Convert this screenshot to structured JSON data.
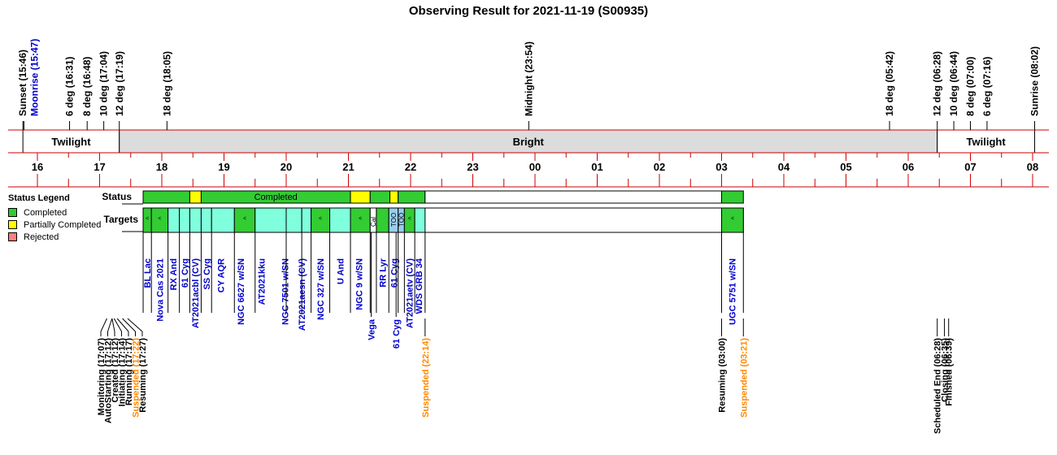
{
  "title": "Observing Result for 2021-11-19 (S00935)",
  "colors": {
    "completed": "#33cc33",
    "partial": "#ffff00",
    "rejected": "#ff8080",
    "twilight_fill": "#ffffff",
    "bright_fill": "#dcdcdc",
    "axis_red": "#cc0000",
    "label_blue": "#0000cc",
    "label_orange": "#ff8800",
    "target_cyan": "#80ffdd",
    "target_blue": "#99ccee"
  },
  "legend": {
    "title": "Status Legend",
    "items": [
      {
        "label": "Completed",
        "color": "#33cc33"
      },
      {
        "label": "Partially Completed",
        "color": "#ffff00"
      },
      {
        "label": "Rejected",
        "color": "#ff8080"
      }
    ]
  },
  "chart_data": {
    "type": "timeline",
    "x_unit": "hour (local time)",
    "xlim": [
      15.6,
      32.0
    ],
    "hour_ticks": [
      16,
      17,
      18,
      19,
      20,
      21,
      22,
      23,
      24,
      25,
      26,
      27,
      28,
      29,
      30,
      31,
      32
    ],
    "hour_tick_labels": [
      "16",
      "17",
      "18",
      "19",
      "20",
      "21",
      "22",
      "23",
      "00",
      "01",
      "02",
      "03",
      "04",
      "05",
      "06",
      "07",
      "08"
    ],
    "sky_events": [
      {
        "label": "Sunset (15:46)",
        "t": 15.767,
        "color": "black"
      },
      {
        "label": "Moonrise (15:47)",
        "t": 15.783,
        "color": "blue"
      },
      {
        "label": "6 deg (16:31)",
        "t": 16.517,
        "color": "black"
      },
      {
        "label": "8 deg (16:48)",
        "t": 16.8,
        "color": "black"
      },
      {
        "label": "10 deg (17:04)",
        "t": 17.067,
        "color": "black"
      },
      {
        "label": "12 deg (17:19)",
        "t": 17.317,
        "color": "black"
      },
      {
        "label": "18 deg (18:05)",
        "t": 18.083,
        "color": "black"
      },
      {
        "label": "Midnight (23:54)",
        "t": 23.9,
        "color": "black"
      },
      {
        "label": "18 deg (05:42)",
        "t": 29.7,
        "color": "black"
      },
      {
        "label": "12 deg (06:28)",
        "t": 30.467,
        "color": "black"
      },
      {
        "label": "10 deg (06:44)",
        "t": 30.733,
        "color": "black"
      },
      {
        "label": "8 deg (07:00)",
        "t": 31.0,
        "color": "black"
      },
      {
        "label": "6 deg (07:16)",
        "t": 31.267,
        "color": "black"
      },
      {
        "label": "Sunrise (08:02)",
        "t": 32.033,
        "color": "black"
      }
    ],
    "sky_bands": [
      {
        "label": "Twilight",
        "start": 15.767,
        "end": 17.317,
        "fill": "twilight"
      },
      {
        "label": "Bright",
        "start": 17.317,
        "end": 30.467,
        "fill": "bright"
      },
      {
        "label": "Twilight",
        "start": 30.467,
        "end": 32.033,
        "fill": "twilight"
      }
    ],
    "status_row_label": "Status",
    "status_segments": [
      {
        "start": 17.7,
        "end": 18.45,
        "status": "completed",
        "label": ""
      },
      {
        "start": 18.45,
        "end": 18.633,
        "status": "partial",
        "label": ""
      },
      {
        "start": 18.633,
        "end": 21.033,
        "status": "completed",
        "label": "Completed"
      },
      {
        "start": 21.033,
        "end": 21.35,
        "status": "partial",
        "label": ""
      },
      {
        "start": 21.35,
        "end": 21.667,
        "status": "completed",
        "label": ""
      },
      {
        "start": 21.667,
        "end": 21.8,
        "status": "partial",
        "label": ""
      },
      {
        "start": 21.8,
        "end": 22.233,
        "status": "completed",
        "label": ""
      },
      {
        "start": 22.233,
        "end": 27.0,
        "status": "idle",
        "label": ""
      },
      {
        "start": 27.0,
        "end": 27.35,
        "status": "completed",
        "label": ""
      }
    ],
    "targets_row_label": "Targets",
    "targets_frame": [
      17.7,
      27.35
    ],
    "target_segments": [
      {
        "start": 17.7,
        "end": 17.833,
        "fill": "completed",
        "mark": "<"
      },
      {
        "start": 17.833,
        "end": 18.1,
        "fill": "completed",
        "mark": "<"
      },
      {
        "start": 18.1,
        "end": 18.283,
        "fill": "cyan",
        "mark": ""
      },
      {
        "start": 18.283,
        "end": 18.45,
        "fill": "cyan",
        "mark": ""
      },
      {
        "start": 18.45,
        "end": 18.633,
        "fill": "cyan",
        "mark": ""
      },
      {
        "start": 18.633,
        "end": 18.8,
        "fill": "cyan",
        "mark": ""
      },
      {
        "start": 18.8,
        "end": 19.167,
        "fill": "cyan",
        "mark": ""
      },
      {
        "start": 19.167,
        "end": 19.5,
        "fill": "completed",
        "mark": "<"
      },
      {
        "start": 19.5,
        "end": 20.0,
        "fill": "cyan",
        "mark": ""
      },
      {
        "start": 20.0,
        "end": 20.25,
        "fill": "cyan",
        "mark": ""
      },
      {
        "start": 20.25,
        "end": 20.4,
        "fill": "cyan",
        "mark": ""
      },
      {
        "start": 20.4,
        "end": 20.7,
        "fill": "completed",
        "mark": "<"
      },
      {
        "start": 20.7,
        "end": 21.033,
        "fill": "cyan",
        "mark": ""
      },
      {
        "start": 21.033,
        "end": 21.35,
        "fill": "completed",
        "mark": "<"
      },
      {
        "start": 21.35,
        "end": 21.45,
        "fill": "white",
        "mark": "Cal"
      },
      {
        "start": 21.45,
        "end": 21.65,
        "fill": "completed",
        "mark": ""
      },
      {
        "start": 21.65,
        "end": 21.8,
        "fill": "blue",
        "mark": "TOO"
      },
      {
        "start": 21.8,
        "end": 21.9,
        "fill": "blue",
        "mark": "TOO"
      },
      {
        "start": 21.9,
        "end": 22.067,
        "fill": "completed",
        "mark": "<"
      },
      {
        "start": 22.067,
        "end": 22.233,
        "fill": "cyan",
        "mark": ""
      },
      {
        "start": 27.0,
        "end": 27.35,
        "fill": "completed",
        "mark": "<"
      }
    ],
    "target_labels": [
      {
        "label": "BL Lac",
        "t": 17.767,
        "color": "blue"
      },
      {
        "label": "Nova Cas 2021",
        "t": 17.967,
        "color": "blue"
      },
      {
        "label": "RX And",
        "t": 18.183,
        "color": "blue"
      },
      {
        "label": "61 Cyg",
        "t": 18.367,
        "color": "blue"
      },
      {
        "label": "AT2021acbl (CV)",
        "t": 18.533,
        "color": "blue"
      },
      {
        "label": "SS Cyg",
        "t": 18.717,
        "color": "blue"
      },
      {
        "label": "CY AQR",
        "t": 18.95,
        "color": "blue"
      },
      {
        "label": "NGC 6627 w/SN",
        "t": 19.267,
        "color": "blue"
      },
      {
        "label": "AT2021kku",
        "t": 19.6,
        "color": "blue"
      },
      {
        "label": "NGC 7501 w/SN",
        "t": 19.983,
        "color": "blue"
      },
      {
        "label": "AT2021aesn (CV)",
        "t": 20.25,
        "color": "blue"
      },
      {
        "label": "NGC 327 w/SN",
        "t": 20.55,
        "color": "blue"
      },
      {
        "label": "U And",
        "t": 20.867,
        "color": "blue"
      },
      {
        "label": "NGC 9 w/SN",
        "t": 21.167,
        "color": "blue"
      },
      {
        "label": "RR Lyr",
        "t": 21.55,
        "color": "blue"
      },
      {
        "label": "61 Cyg",
        "t": 21.733,
        "color": "blue"
      },
      {
        "label": "AT2021aetv (CV)",
        "t": 21.983,
        "color": "blue"
      },
      {
        "label": "WDS GRB 34",
        "t": 22.133,
        "color": "blue"
      },
      {
        "label": "UGC 5751 w/SN",
        "t": 27.167,
        "color": "blue"
      }
    ],
    "target_labels_low": [
      {
        "label": "Vega",
        "t": 21.367,
        "color": "blue"
      },
      {
        "label": "61 Cyg",
        "t": 21.767,
        "color": "blue"
      }
    ],
    "ops_events": [
      {
        "label": "Monitoring (17:07)",
        "t": 17.117,
        "color": "black"
      },
      {
        "label": "AutoStarting (17:12)",
        "t": 17.2,
        "color": "black"
      },
      {
        "label": "Created (17:12)",
        "t": 17.2,
        "color": "black"
      },
      {
        "label": "Initiating (17:14)",
        "t": 17.233,
        "color": "black"
      },
      {
        "label": "Running (17:17)",
        "t": 17.283,
        "color": "black"
      },
      {
        "label": "Suspended (17:22)",
        "t": 17.367,
        "color": "orange"
      },
      {
        "label": "Resuming (17:27)",
        "t": 17.45,
        "color": "black"
      },
      {
        "label": "Suspended (22:14)",
        "t": 22.233,
        "color": "orange"
      },
      {
        "label": "Resuming (03:00)",
        "t": 27.0,
        "color": "black"
      },
      {
        "label": "Suspended (03:21)",
        "t": 27.35,
        "color": "orange"
      },
      {
        "label": "Scheduled End (06:28)",
        "t": 30.467,
        "color": "black"
      },
      {
        "label": "Closing (06:35)",
        "t": 30.583,
        "color": "black"
      },
      {
        "label": "Finished (06:39)",
        "t": 30.65,
        "color": "black"
      }
    ]
  }
}
